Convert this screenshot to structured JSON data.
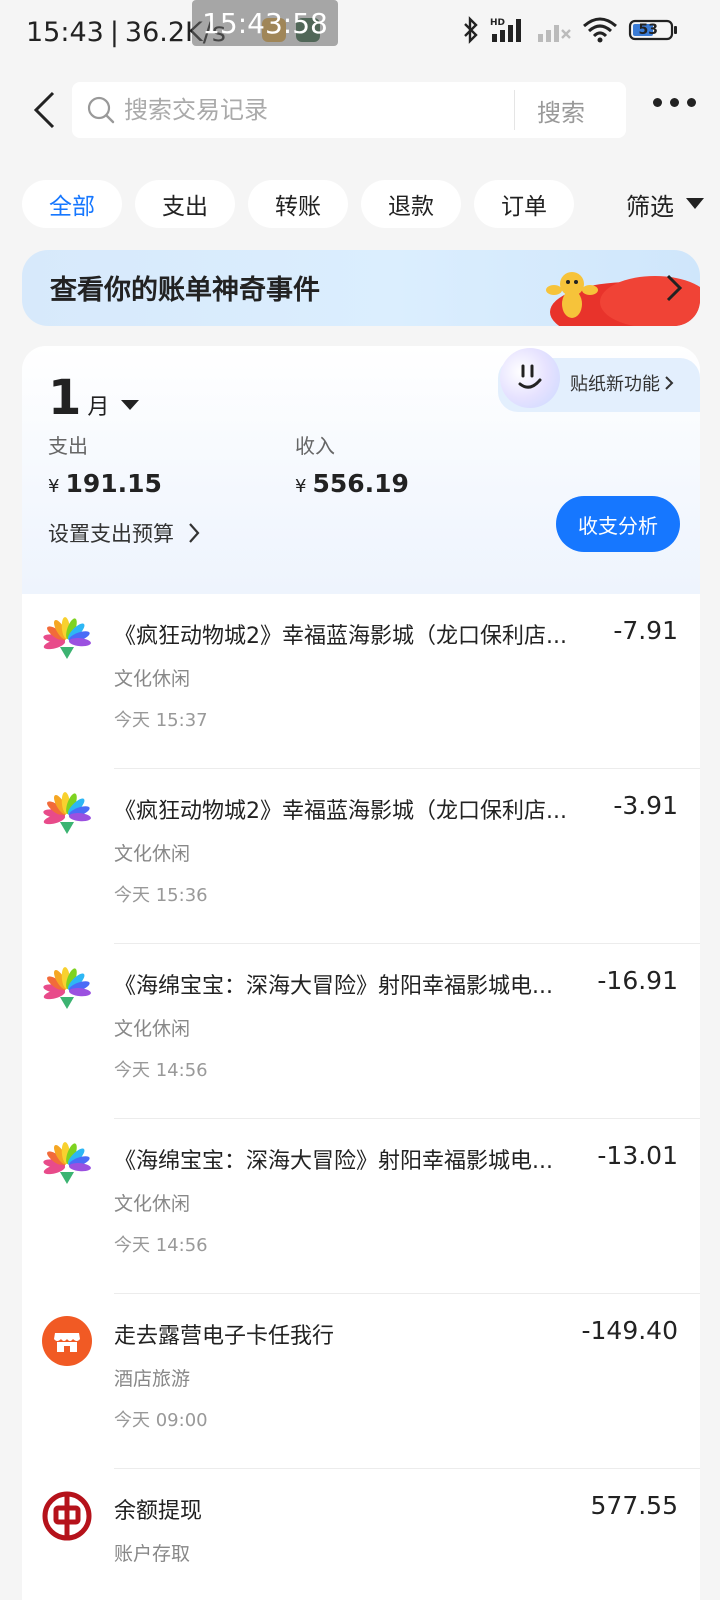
{
  "status_bar": {
    "time": "15:43",
    "speed": "36.2K/s",
    "clock_overlay": "15:43:58",
    "battery": "53"
  },
  "header": {
    "search_placeholder": "搜索交易记录",
    "search_button": "搜索"
  },
  "filters": {
    "tabs": [
      "全部",
      "支出",
      "转账",
      "退款",
      "订单"
    ],
    "select_label": "筛选"
  },
  "banner": {
    "text": "查看你的账单神奇事件"
  },
  "summary": {
    "sticker_label": "贴纸新功能",
    "month": "1",
    "month_unit": "月",
    "expense_label": "支出",
    "expense_value": "191.15",
    "income_label": "收入",
    "income_value": "556.19",
    "currency": "¥",
    "budget_label": "设置支出预算",
    "analysis_button": "收支分析"
  },
  "transactions": [
    {
      "title": "《疯狂动物城2》幸福蓝海影城（龙口保利店...",
      "category": "文化休闲",
      "time": "今天 15:37",
      "amount": "-7.91",
      "icon": "movie-flower-icon"
    },
    {
      "title": "《疯狂动物城2》幸福蓝海影城（龙口保利店...",
      "category": "文化休闲",
      "time": "今天 15:36",
      "amount": "-3.91",
      "icon": "movie-flower-icon"
    },
    {
      "title": "《海绵宝宝：深海大冒险》射阳幸福影城电...",
      "category": "文化休闲",
      "time": "今天 14:56",
      "amount": "-16.91",
      "icon": "movie-flower-icon"
    },
    {
      "title": "《海绵宝宝：深海大冒险》射阳幸福影城电...",
      "category": "文化休闲",
      "time": "今天 14:56",
      "amount": "-13.01",
      "icon": "movie-flower-icon"
    },
    {
      "title": "走去露营电子卡任我行",
      "category": "酒店旅游",
      "time": "今天 09:00",
      "amount": "-149.40",
      "icon": "shop-icon"
    },
    {
      "title": "余额提现",
      "category": "账户存取",
      "time": "",
      "amount": "577.55",
      "icon": "bank-icon"
    }
  ],
  "colors": {
    "accent": "#1677ff",
    "background": "#f5f5f5"
  }
}
